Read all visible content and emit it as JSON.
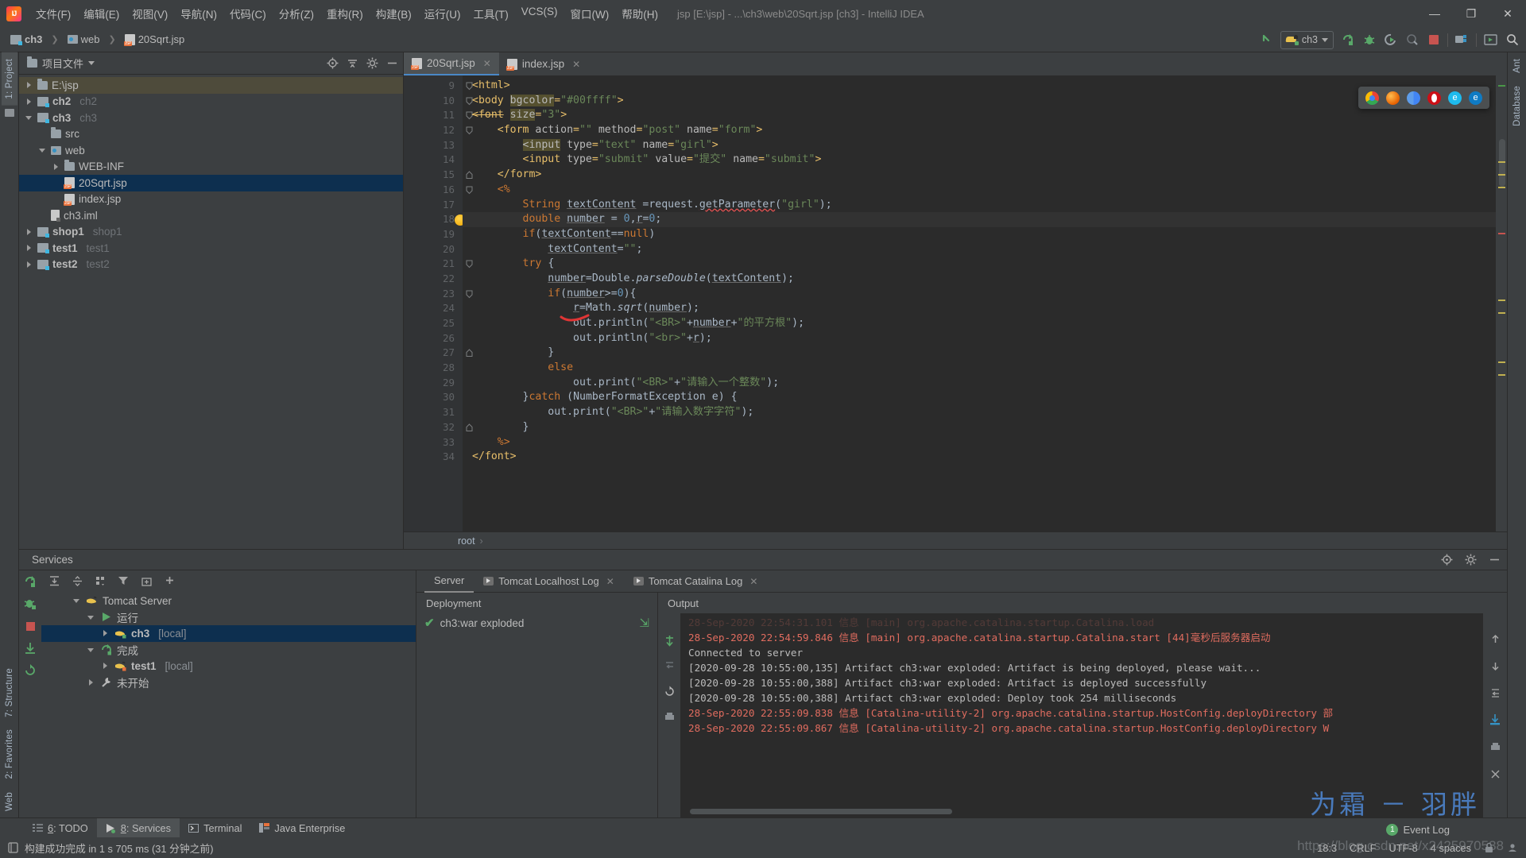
{
  "window": {
    "title": "jsp [E:\\jsp] - ...\\ch3\\web\\20Sqrt.jsp [ch3] - IntelliJ IDEA",
    "minimize": "—",
    "maximize": "❐",
    "close": "✕"
  },
  "menu": {
    "items": [
      "文件(F)",
      "编辑(E)",
      "视图(V)",
      "导航(N)",
      "代码(C)",
      "分析(Z)",
      "重构(R)",
      "构建(B)",
      "运行(U)",
      "工具(T)",
      "VCS(S)",
      "窗口(W)",
      "帮助(H)"
    ]
  },
  "navbar": {
    "crumbs": [
      {
        "label": "ch3",
        "icon": "module-folder-icon"
      },
      {
        "label": "web",
        "icon": "web-folder-icon"
      },
      {
        "label": "20Sqrt.jsp",
        "icon": "jsp-file-icon"
      }
    ],
    "run_config": "ch3",
    "icons": [
      "back-arrow-icon",
      "run-icon",
      "debug-icon",
      "run-coverage-icon",
      "profile-icon",
      "stop-icon",
      "build-artifacts-icon",
      "update-app-icon",
      "search-everywhere-icon"
    ]
  },
  "left_strip": {
    "tabs": [
      {
        "label": "1: Project",
        "active": true
      }
    ],
    "bottom_tabs": [
      {
        "label": "7: Structure"
      },
      {
        "label": "2: Favorites"
      },
      {
        "label": "Web"
      }
    ]
  },
  "right_strip": {
    "tabs": [
      "Ant",
      "Database"
    ]
  },
  "project": {
    "title": "项目文件",
    "header_icons": [
      "locate-icon",
      "collapse-all-icon",
      "settings-gear-icon",
      "hide-icon"
    ],
    "tree": [
      {
        "indent": 0,
        "arrow": "right",
        "icon": "folder-icon",
        "label": "E:\\jsp",
        "secondary": "",
        "bold": false,
        "selected": false,
        "highlight": true
      },
      {
        "indent": 0,
        "arrow": "right",
        "icon": "module-icon",
        "label": "ch2",
        "secondary": "ch2",
        "bold": true,
        "selected": false,
        "highlight": false
      },
      {
        "indent": 0,
        "arrow": "down",
        "icon": "module-icon",
        "label": "ch3",
        "secondary": "ch3",
        "bold": true,
        "selected": false,
        "highlight": false
      },
      {
        "indent": 1,
        "arrow": "none",
        "icon": "folder-icon",
        "label": "src",
        "secondary": "",
        "bold": false,
        "selected": false,
        "highlight": false
      },
      {
        "indent": 1,
        "arrow": "down",
        "icon": "web-folder-icon",
        "label": "web",
        "secondary": "",
        "bold": false,
        "selected": false,
        "highlight": false
      },
      {
        "indent": 2,
        "arrow": "right",
        "icon": "folder-icon",
        "label": "WEB-INF",
        "secondary": "",
        "bold": false,
        "selected": false,
        "highlight": false
      },
      {
        "indent": 2,
        "arrow": "none",
        "icon": "jsp-file-icon",
        "label": "20Sqrt.jsp",
        "secondary": "",
        "bold": false,
        "selected": true,
        "highlight": false
      },
      {
        "indent": 2,
        "arrow": "none",
        "icon": "jsp-file-icon",
        "label": "index.jsp",
        "secondary": "",
        "bold": false,
        "selected": false,
        "highlight": false
      },
      {
        "indent": 1,
        "arrow": "none",
        "icon": "iml-file-icon",
        "label": "ch3.iml",
        "secondary": "",
        "bold": false,
        "selected": false,
        "highlight": false
      },
      {
        "indent": 0,
        "arrow": "right",
        "icon": "module-icon",
        "label": "shop1",
        "secondary": "shop1",
        "bold": true,
        "selected": false,
        "highlight": false
      },
      {
        "indent": 0,
        "arrow": "right",
        "icon": "module-icon",
        "label": "test1",
        "secondary": "test1",
        "bold": true,
        "selected": false,
        "highlight": false
      },
      {
        "indent": 0,
        "arrow": "right",
        "icon": "module-icon",
        "label": "test2",
        "secondary": "test2",
        "bold": true,
        "selected": false,
        "highlight": false
      }
    ]
  },
  "editor": {
    "tabs": [
      {
        "label": "20Sqrt.jsp",
        "active": true,
        "close": "✕"
      },
      {
        "label": "index.jsp",
        "active": false,
        "close": "✕"
      }
    ],
    "first_line": 9,
    "current_line": 18,
    "breadcrumb": [
      "root"
    ],
    "breadcrumb_sep": "›",
    "lines": [
      {
        "n": 9,
        "fold": "start",
        "html": "<span class=\"tag\">&lt;html&gt;</span>"
      },
      {
        "n": 10,
        "fold": "start",
        "html": "<span class=\"tag\">&lt;body </span><span class=\"attrhl\">bgcolor</span><span class=\"tag\">=</span><span class=\"str\">\"#00ffff\"</span><span class=\"tag\">&gt;</span>"
      },
      {
        "n": 11,
        "fold": "start",
        "html": "<span class=\"tag strike\">&lt;font</span><span class=\"tag\"> </span><span class=\"attrhl\">size</span><span class=\"tag\">=</span><span class=\"str\">\"3\"</span><span class=\"tag\">&gt;</span>"
      },
      {
        "n": 12,
        "fold": "start",
        "html": "    <span class=\"tag\">&lt;form </span><span class=\"attr\">action</span><span class=\"tag\">=</span><span class=\"str\">\"\"</span><span class=\"tag\"> </span><span class=\"attr\">method</span><span class=\"tag\">=</span><span class=\"str\">\"post\"</span><span class=\"tag\"> </span><span class=\"attr\">name</span><span class=\"tag\">=</span><span class=\"str\">\"form\"</span><span class=\"tag\">&gt;</span>"
      },
      {
        "n": 13,
        "fold": "none",
        "html": "        <span class=\"attrhl\">&lt;input</span><span class=\"tag\"> </span><span class=\"attr\">type</span><span class=\"tag\">=</span><span class=\"str\">\"text\"</span><span class=\"tag\"> </span><span class=\"attr\">name</span><span class=\"tag\">=</span><span class=\"str\">\"girl\"</span><span class=\"tag\">&gt;</span>"
      },
      {
        "n": 14,
        "fold": "none",
        "html": "        <span class=\"tag\">&lt;input </span><span class=\"attr\">type</span><span class=\"tag\">=</span><span class=\"str\">\"submit\"</span><span class=\"tag\"> </span><span class=\"attr\">value</span><span class=\"tag\">=</span><span class=\"str\">\"提交\"</span><span class=\"tag\"> </span><span class=\"attr\">name</span><span class=\"tag\">=</span><span class=\"str\">\"submit\"</span><span class=\"tag\">&gt;</span>"
      },
      {
        "n": 15,
        "fold": "end",
        "html": "    <span class=\"tag\">&lt;/form&gt;</span>"
      },
      {
        "n": 16,
        "fold": "start",
        "html": "    <span class=\"kw\">&lt;%</span>"
      },
      {
        "n": 17,
        "fold": "none",
        "html": "        <span class=\"kw\">String</span> <span class=\"plain und\">textContent</span> <span class=\"plain\">=request.</span><span class=\"plain undr\">getParameter</span><span class=\"plain\">(</span><span class=\"str\">\"girl\"</span><span class=\"plain\">);</span>"
      },
      {
        "n": 18,
        "fold": "none",
        "html": "        <span class=\"kw\">double</span> <span class=\"plain und\">number</span> <span class=\"plain\">= </span><span class=\"num\">0</span><span class=\"plain\">,</span><span class=\"plain und\">r</span><span class=\"plain\">=</span><span class=\"num\">0</span><span class=\"plain\">;</span>"
      },
      {
        "n": 19,
        "fold": "none",
        "html": "        <span class=\"kw\">if</span><span class=\"plain\">(</span><span class=\"plain und\">textContent</span><span class=\"plain\">==</span><span class=\"kw\">null</span><span class=\"plain\">)</span>"
      },
      {
        "n": 20,
        "fold": "none",
        "html": "            <span class=\"plain und\">textContent</span><span class=\"plain\">=</span><span class=\"str\">\"\"</span><span class=\"plain\">;</span>"
      },
      {
        "n": 21,
        "fold": "start",
        "html": "        <span class=\"kw\">try</span> <span class=\"plain\">{</span>"
      },
      {
        "n": 22,
        "fold": "none",
        "html": "            <span class=\"plain und\">number</span><span class=\"plain\">=Double.</span><span class=\"ital\">parseDouble</span><span class=\"plain\">(</span><span class=\"plain und\">textContent</span><span class=\"plain\">);</span>"
      },
      {
        "n": 23,
        "fold": "start",
        "html": "            <span class=\"kw\">if</span><span class=\"plain\">(</span><span class=\"plain und\">number</span><span class=\"plain\">&gt;=</span><span class=\"num\">0</span><span class=\"plain\">){</span>"
      },
      {
        "n": 24,
        "fold": "none",
        "html": "                <span class=\"plain und\">r</span><span class=\"plain\">=Math.</span><span class=\"ital\">sqrt</span><span class=\"plain\">(</span><span class=\"plain und\">number</span><span class=\"plain\">);</span>"
      },
      {
        "n": 25,
        "fold": "none",
        "html": "                <span class=\"plain\">out.println(</span><span class=\"str\">\"&lt;BR&gt;\"</span><span class=\"plain\">+</span><span class=\"plain und\">number</span><span class=\"plain\">+</span><span class=\"str\">\"的平方根\"</span><span class=\"plain\">);</span>"
      },
      {
        "n": 26,
        "fold": "none",
        "html": "                <span class=\"plain\">out.println(</span><span class=\"str\">\"&lt;br&gt;\"</span><span class=\"plain\">+</span><span class=\"plain und\">r</span><span class=\"plain\">);</span>"
      },
      {
        "n": 27,
        "fold": "end",
        "html": "            <span class=\"plain\">}</span>"
      },
      {
        "n": 28,
        "fold": "none",
        "html": "            <span class=\"kw\">else</span>"
      },
      {
        "n": 29,
        "fold": "none",
        "html": "                <span class=\"plain\">out.print(</span><span class=\"str\">\"&lt;BR&gt;\"</span><span class=\"plain\">+</span><span class=\"str\">\"请输入一个整数\"</span><span class=\"plain\">);</span>"
      },
      {
        "n": 30,
        "fold": "none",
        "html": "        <span class=\"plain\">}</span><span class=\"kw\">catch</span> <span class=\"plain\">(NumberFormatException e) {</span>"
      },
      {
        "n": 31,
        "fold": "none",
        "html": "            <span class=\"plain\">out.print(</span><span class=\"str\">\"&lt;BR&gt;\"</span><span class=\"plain\">+</span><span class=\"str\">\"请输入数字字符\"</span><span class=\"plain\">);</span>"
      },
      {
        "n": 32,
        "fold": "end",
        "html": "        <span class=\"plain\">}</span>"
      },
      {
        "n": 33,
        "fold": "none",
        "html": "    <span class=\"kw\">%&gt;</span>"
      },
      {
        "n": 34,
        "fold": "none",
        "html": "<span class=\"tag\">&lt;/font&gt;</span>"
      }
    ],
    "browser_popup": [
      "chrome-icon",
      "firefox-icon",
      "opera-icon",
      "safari-icon",
      "ie-icon",
      "edge-icon"
    ]
  },
  "services": {
    "title": "Services",
    "header_icons": [
      "locate-icon",
      "settings-gear-icon",
      "hide-icon"
    ],
    "toolbar_icons": [
      "rerun-icon",
      "expand-all-icon",
      "collapse-all-icon",
      "group-icon",
      "filter-icon",
      "add-tab-icon",
      "add-icon"
    ],
    "side_icons": [
      "rerun-service-icon",
      "debug-service-icon",
      "stop-service-icon",
      "deploy-icon",
      "restart-icon"
    ],
    "tree": [
      {
        "indent": 0,
        "arrow": "down",
        "icon": "tomcat-icon",
        "label": "Tomcat Server",
        "suffix": "",
        "bold": false,
        "selected": false
      },
      {
        "indent": 1,
        "arrow": "down",
        "icon": "run-green-icon",
        "label": "运行",
        "suffix": "",
        "bold": false,
        "selected": false
      },
      {
        "indent": 2,
        "arrow": "right",
        "icon": "tomcat-running-icon",
        "label": "ch3",
        "suffix": "[local]",
        "bold": true,
        "selected": true
      },
      {
        "indent": 1,
        "arrow": "down",
        "icon": "finished-icon",
        "label": "完成",
        "suffix": "",
        "bold": false,
        "selected": false
      },
      {
        "indent": 2,
        "arrow": "right",
        "icon": "tomcat-stopped-icon",
        "label": "test1",
        "suffix": "[local]",
        "bold": true,
        "selected": false
      },
      {
        "indent": 1,
        "arrow": "right",
        "icon": "wrench-icon",
        "label": "未开始",
        "suffix": "",
        "bold": false,
        "selected": false
      }
    ],
    "tabs": [
      {
        "label": "Server",
        "active": true,
        "icon": "",
        "close": ""
      },
      {
        "label": "Tomcat Localhost Log",
        "active": false,
        "icon": "console-icon",
        "close": "✕"
      },
      {
        "label": "Tomcat Catalina Log",
        "active": false,
        "icon": "console-icon",
        "close": "✕"
      }
    ],
    "deployment": {
      "title": "Deployment",
      "rows": [
        {
          "label": "ch3:war exploded",
          "status": "✔"
        }
      ]
    },
    "output": {
      "title": "Output",
      "lines": [
        {
          "text": "28-Sep-2020 22:54:31.101 信息 [main] org.apache.catalina.startup.Catalina.load",
          "style": "faded"
        },
        {
          "text": "28-Sep-2020 22:54:59.846 信息 [main] org.apache.catalina.startup.Catalina.start [44]毫秒后服务器启动",
          "style": "err"
        },
        {
          "text": "Connected to server",
          "style": "normal"
        },
        {
          "text": "[2020-09-28 10:55:00,135] Artifact ch3:war exploded: Artifact is being deployed, please wait...",
          "style": "normal"
        },
        {
          "text": "[2020-09-28 10:55:00,388] Artifact ch3:war exploded: Artifact is deployed successfully",
          "style": "normal"
        },
        {
          "text": "[2020-09-28 10:55:00,388] Artifact ch3:war exploded: Deploy took 254 milliseconds",
          "style": "normal"
        },
        {
          "text": "28-Sep-2020 22:55:09.838 信息 [Catalina-utility-2] org.apache.catalina.startup.HostConfig.deployDirectory 部",
          "style": "err"
        },
        {
          "text": "28-Sep-2020 22:55:09.867 信息 [Catalina-utility-2] org.apache.catalina.startup.HostConfig.deployDirectory W",
          "style": "err"
        }
      ]
    }
  },
  "toolwindow_bar": {
    "tabs": [
      {
        "num": "6",
        "label": ": TODO",
        "active": false,
        "icon": "todo-icon"
      },
      {
        "num": "8",
        "label": ": Services",
        "active": true,
        "icon": "services-icon"
      },
      {
        "num": "",
        "label": "Terminal",
        "active": false,
        "icon": "terminal-icon"
      },
      {
        "num": "",
        "label": "Java Enterprise",
        "active": false,
        "icon": "java-enterprise-icon"
      }
    ]
  },
  "statusbar": {
    "message": "构建成功完成 in 1 s 705 ms (31 分钟之前)",
    "icon": "build-icon",
    "position": "18:3",
    "line_sep": "CRLF",
    "encoding": "UTF-8",
    "indent": "4 spaces",
    "event_log": "Event Log",
    "event_count": "1",
    "lock_icon": "lock-icon",
    "hector_icon": "hector-icon"
  },
  "watermark": {
    "text": "为霜 － 羽胖",
    "url": "https://blog.csdn.net/x2425970538"
  },
  "colors": {
    "accent_blue": "#4a88c7",
    "selection": "#0d2f4f",
    "green": "#59a869",
    "error_red": "#e06c5f",
    "string_green": "#6a8759",
    "keyword_orange": "#cc7832",
    "tag_yellow": "#e8bf6a",
    "panel_bg": "#3c3f41",
    "editor_bg": "#2b2b2b"
  }
}
